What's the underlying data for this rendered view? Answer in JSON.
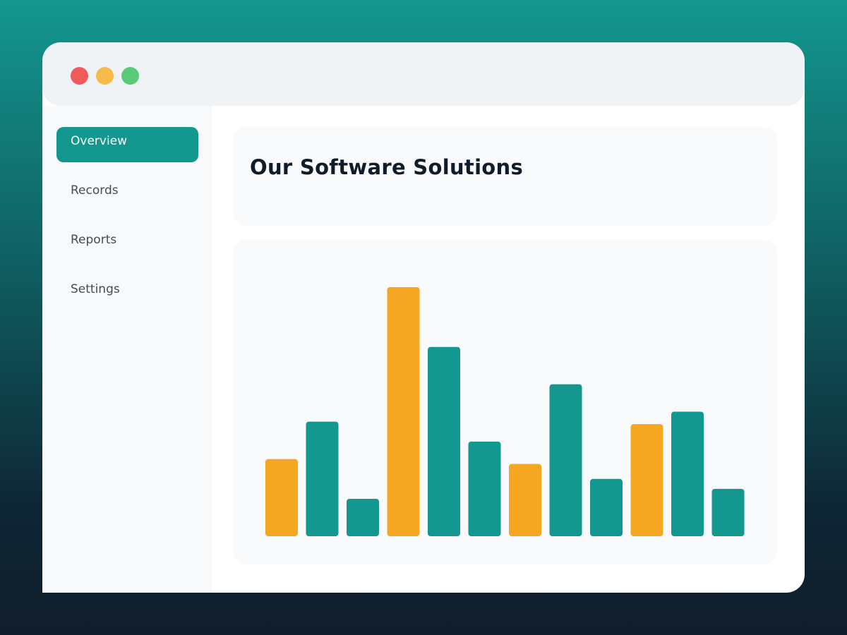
{
  "window": {
    "controls": [
      {
        "name": "close-dot",
        "color": "#ef5b5b"
      },
      {
        "name": "minimize-dot",
        "color": "#f6bb4a"
      },
      {
        "name": "maximize-dot",
        "color": "#5ac978"
      }
    ]
  },
  "sidebar": {
    "items": [
      {
        "label": "Overview",
        "active": true
      },
      {
        "label": "Records",
        "active": false
      },
      {
        "label": "Reports",
        "active": false
      },
      {
        "label": "Settings",
        "active": false
      }
    ]
  },
  "header": {
    "title": "Our Software Solutions"
  },
  "colors": {
    "accent": "#13978f",
    "highlight": "#f5a623"
  },
  "chart_data": {
    "type": "bar",
    "title": "",
    "xlabel": "",
    "ylabel": "",
    "ylim": [
      0,
      100
    ],
    "grid": false,
    "legend": "none",
    "values": [
      31,
      46,
      15,
      100,
      76,
      38,
      29,
      61,
      23,
      45,
      50,
      19
    ],
    "colors": [
      "#f5a623",
      "#13978f",
      "#13978f",
      "#f5a623",
      "#13978f",
      "#13978f",
      "#f5a623",
      "#13978f",
      "#13978f",
      "#f5a623",
      "#13978f",
      "#13978f"
    ]
  }
}
